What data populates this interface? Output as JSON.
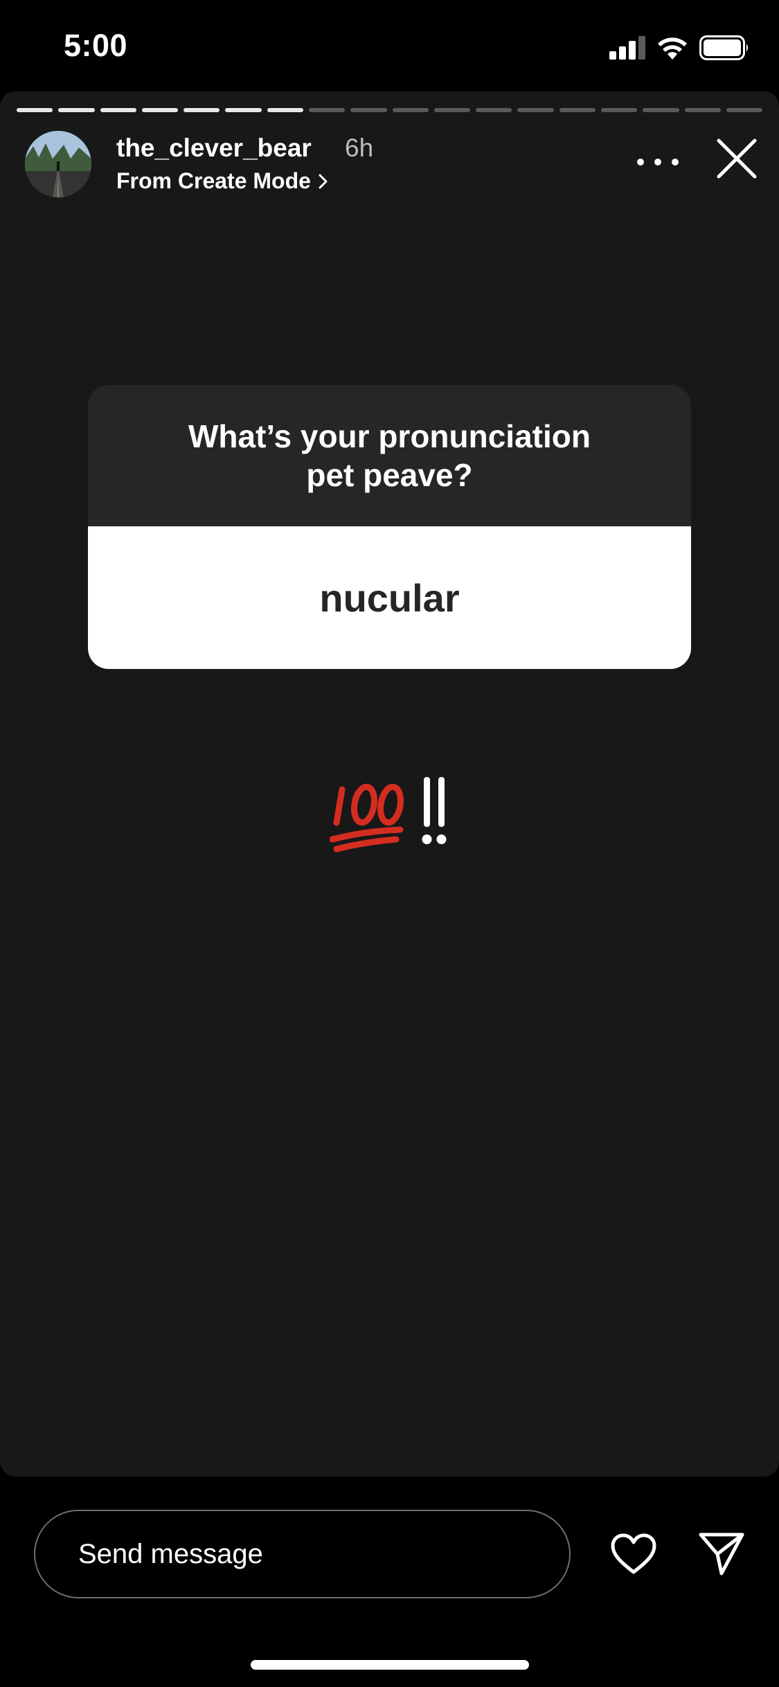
{
  "status_bar": {
    "time": "5:00",
    "icons": [
      "cellular-signal-icon",
      "wifi-icon",
      "battery-icon"
    ]
  },
  "story": {
    "progress": {
      "total_segments": 18,
      "seen_segments": 7
    },
    "username": "the_clever_bear",
    "age": "6h",
    "subline": "From Create Mode",
    "header_icons": [
      "more-icon",
      "close-icon"
    ]
  },
  "sticker": {
    "question": "What’s your pronunciation pet peave?",
    "answer": "nucular"
  },
  "emoji": {
    "hundred": "💯",
    "exclaim": "‼"
  },
  "bottom_bar": {
    "message_placeholder": "Send message",
    "icons": [
      "heart-icon",
      "send-icon"
    ]
  },
  "colors": {
    "background": "#000000",
    "story_background": "#181818",
    "sticker_question_bg": "#262626",
    "sticker_answer_bg": "#ffffff",
    "emoji_red": "#d42d20"
  }
}
